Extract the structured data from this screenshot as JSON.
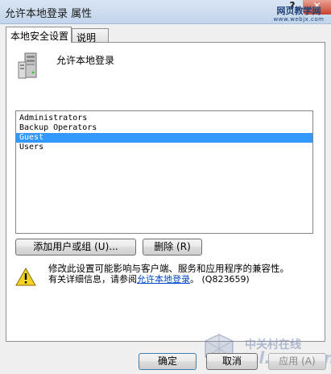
{
  "window": {
    "title": "允许本地登录 属性",
    "help_glyph": "?",
    "close_glyph": "✕"
  },
  "watermarks": {
    "top_line1": "网页教学网",
    "top_line2": "www.webjx.com",
    "bottom_cn": "中关村在线",
    "bottom_en": "zol.com.cn"
  },
  "tabs": [
    {
      "label": "本地安全设置",
      "active": true
    },
    {
      "label": "说明",
      "active": false
    }
  ],
  "policy": {
    "name": "允许本地登录",
    "icon": "server-icon"
  },
  "members": {
    "items": [
      "Administrators",
      "Backup Operators",
      "Guest",
      "Users"
    ],
    "selected_index": 2
  },
  "actions": {
    "add_label": "添加用户或组 (U)...",
    "remove_label": "删除 (R)"
  },
  "warning": {
    "icon": "warning-icon",
    "line1": "修改此设置可能影响与客户端、服务和应用程序的兼容性。",
    "line2_prefix": "有关详细信息，请参阅",
    "link_text": "允许本地登录",
    "line2_suffix": "。 (Q823659)"
  },
  "footer": {
    "ok_label": "确定",
    "cancel_label": "取消",
    "apply_label": "应用 (A)"
  },
  "colors": {
    "selection": "#3399ff",
    "link": "#0047cc",
    "titlebar": "#c2d5ec"
  }
}
